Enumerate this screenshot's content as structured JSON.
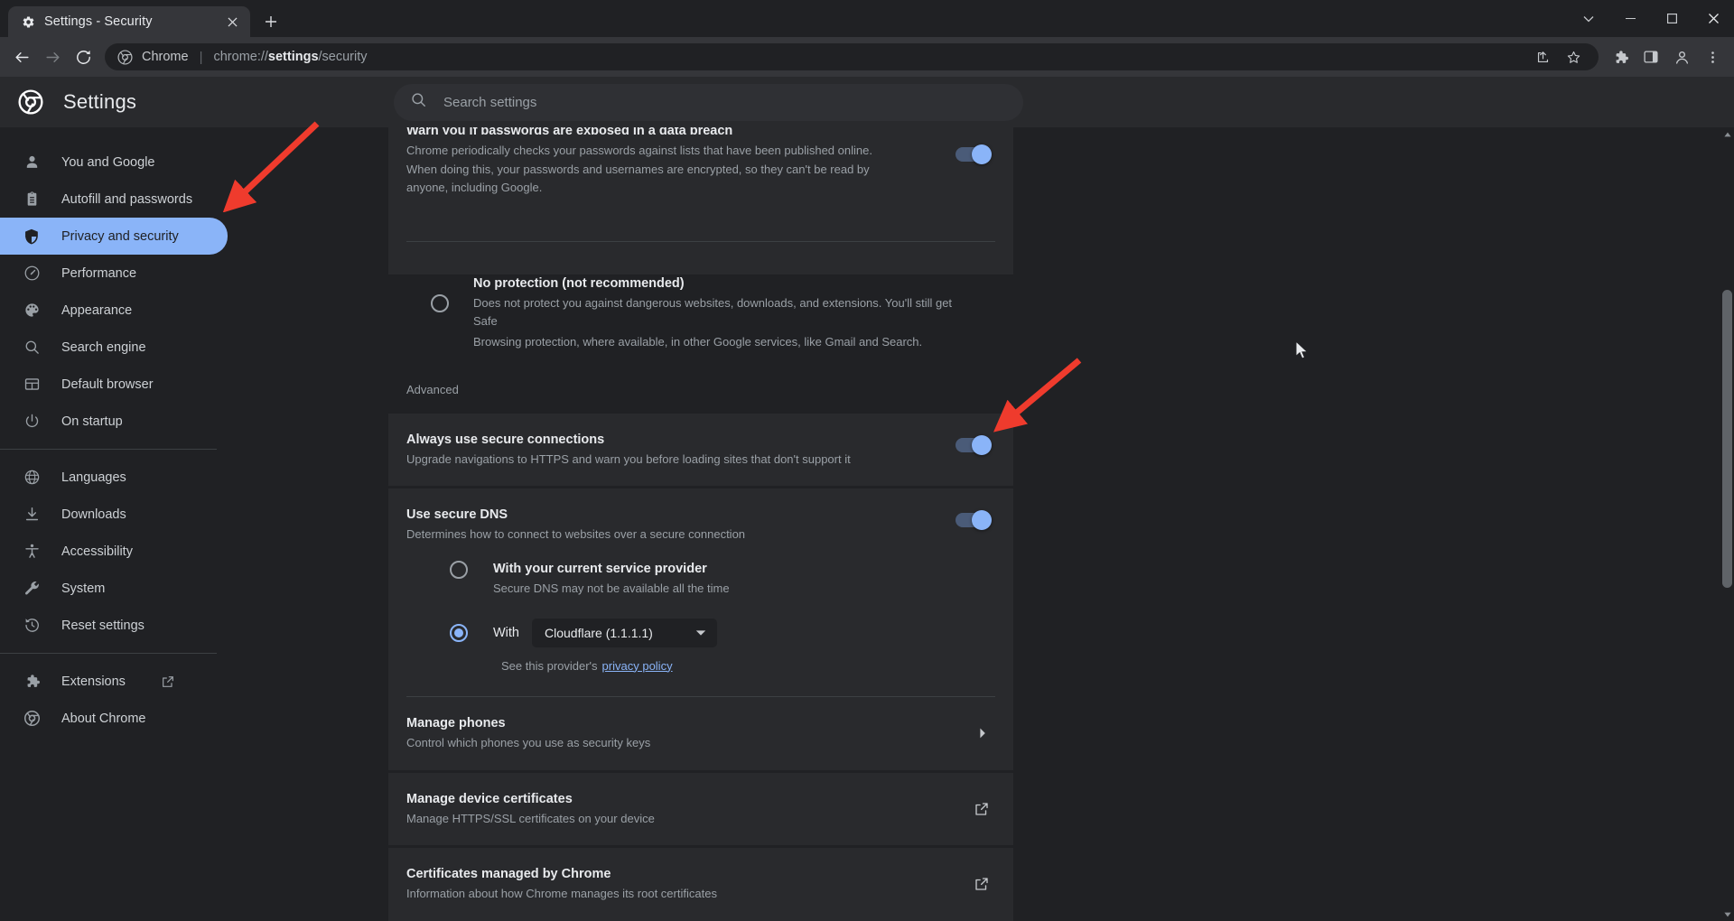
{
  "window": {
    "tab_title": "Settings - Security",
    "tab_favicon": "gear-icon",
    "new_tab_label": "+",
    "close_tab_label": "×",
    "minimize_label": "─",
    "maximize_label": "□",
    "close_label": "✕",
    "chevron_label": "⌄"
  },
  "toolbar": {
    "back_icon": "back-arrow-icon",
    "forward_icon": "forward-arrow-icon",
    "reload_icon": "reload-icon",
    "omnibox": {
      "chrome_icon": "chrome-icon",
      "scheme_label": "Chrome",
      "separator": "|",
      "url_prefix": "chrome://",
      "url_bold": "settings",
      "url_suffix": "/security"
    },
    "share_icon": "share-icon",
    "bookmark_icon": "star-icon",
    "extensions_icon": "puzzle-icon",
    "sidepanel_icon": "side-panel-icon",
    "profile_icon": "profile-icon",
    "menu_icon": "three-dot-menu-icon"
  },
  "settings": {
    "brand_title": "Settings",
    "brand_logo": "chrome-logo-icon",
    "search": {
      "icon": "search-icon",
      "placeholder": "Search settings",
      "value": ""
    }
  },
  "sidebar": {
    "items": [
      {
        "label": "You and Google",
        "icon": "person-icon",
        "selected": false
      },
      {
        "label": "Autofill and passwords",
        "icon": "clipboard-icon",
        "selected": false
      },
      {
        "label": "Privacy and security",
        "icon": "shield-icon",
        "selected": true
      },
      {
        "label": "Performance",
        "icon": "speedometer-icon",
        "selected": false
      },
      {
        "label": "Appearance",
        "icon": "palette-icon",
        "selected": false
      },
      {
        "label": "Search engine",
        "icon": "search-icon",
        "selected": false
      },
      {
        "label": "Default browser",
        "icon": "browser-window-icon",
        "selected": false
      },
      {
        "label": "On startup",
        "icon": "power-icon",
        "selected": false
      }
    ],
    "items_group2": [
      {
        "label": "Languages",
        "icon": "globe-icon"
      },
      {
        "label": "Downloads",
        "icon": "download-icon"
      },
      {
        "label": "Accessibility",
        "icon": "accessibility-icon"
      },
      {
        "label": "System",
        "icon": "wrench-icon"
      },
      {
        "label": "Reset settings",
        "icon": "history-restore-icon"
      }
    ],
    "items_group3": [
      {
        "label": "Extensions",
        "icon": "puzzle-icon",
        "external": true
      },
      {
        "label": "About Chrome",
        "icon": "chrome-logo-icon",
        "external": false
      }
    ]
  },
  "main": {
    "breach_warning": {
      "title": "Warn you if passwords are exposed in a data breach",
      "desc_line1": "Chrome periodically checks your passwords against lists that have been published online.",
      "desc_line2": "When doing this, your passwords and usernames are encrypted, so they can't be read by",
      "desc_line3": "anyone, including Google.",
      "toggle_on": true
    },
    "no_protection": {
      "title": "No protection (not recommended)",
      "desc_line1": "Does not protect you against dangerous websites, downloads, and extensions. You'll still get Safe",
      "desc_line2": "Browsing protection, where available, in other Google services, like Gmail and Search.",
      "selected": false
    },
    "advanced_label": "Advanced",
    "secure_connections": {
      "title": "Always use secure connections",
      "desc": "Upgrade navigations to HTTPS and warn you before loading sites that don't support it",
      "toggle_on": true
    },
    "secure_dns": {
      "title": "Use secure DNS",
      "desc": "Determines how to connect to websites over a secure connection",
      "toggle_on": true,
      "option_current": {
        "label": "With your current service provider",
        "sub": "Secure DNS may not be available all the time",
        "selected": false
      },
      "option_with": {
        "prefix": "With",
        "selected": true,
        "dropdown_value": "Cloudflare (1.1.1.1)",
        "dropdown_caret": "▾",
        "policy_prefix": "See this provider's",
        "policy_link": "privacy policy"
      }
    },
    "manage_phones": {
      "title": "Manage phones",
      "desc": "Control which phones you use as security keys",
      "chevron": "▸"
    },
    "manage_device_certificates": {
      "title": "Manage device certificates",
      "desc": "Manage HTTPS/SSL certificates on your device",
      "icon": "external-link-icon"
    },
    "certificates_managed_by_chrome": {
      "title": "Certificates managed by Chrome",
      "desc": "Information about how Chrome manages its root certificates",
      "icon": "external-link-icon"
    }
  },
  "annotations": {
    "arrow_sidebar": "red-arrow-pointing-to-privacy-and-security",
    "arrow_toggle": "red-arrow-pointing-to-always-use-secure-connections-toggle",
    "accent_color": "#8ab4f8",
    "annotation_color": "#ef3b2d"
  },
  "scrollbar": {
    "up_arrow": "▴",
    "down_arrow": "▾"
  }
}
